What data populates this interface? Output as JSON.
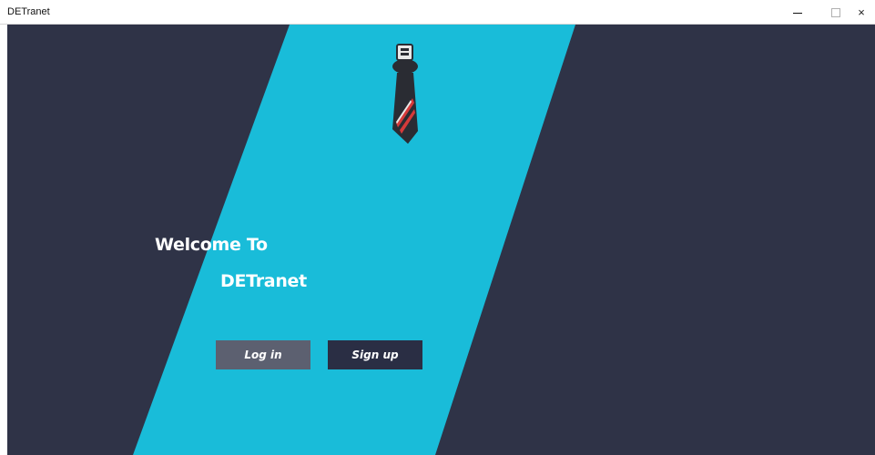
{
  "window": {
    "title": "DETranet",
    "minimize_icon": "minimize-icon",
    "maximize_icon": "maximize-icon",
    "close_icon": "close-icon",
    "close_glyph": "×"
  },
  "hero": {
    "welcome": "Welcome To",
    "app_name": "DETranet"
  },
  "buttons": {
    "login_label": "Log in",
    "signup_label": "Sign up"
  },
  "colors": {
    "background": "#2f3347",
    "accent": "#19bcd9",
    "login_button": "#5c6070",
    "signup_button": "#2a2e44"
  },
  "logo": {
    "icon": "necktie-logo-icon"
  }
}
